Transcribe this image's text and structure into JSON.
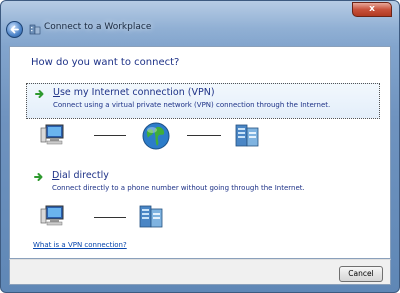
{
  "window": {
    "title": "Connect to a Workplace",
    "close_label": "x"
  },
  "main": {
    "heading": "How do you want to connect?",
    "options": [
      {
        "title_underlined": "U",
        "title_rest": "se my Internet connection (VPN)",
        "description": "Connect using a virtual private network (VPN) connection through the Internet."
      },
      {
        "title_underlined": "D",
        "title_rest": "ial directly",
        "description": "Connect directly to a phone number without going through the Internet."
      }
    ],
    "help_link": "What is a VPN connection?"
  },
  "footer": {
    "cancel_label": "Cancel"
  },
  "colors": {
    "accent_text": "#1e3287",
    "link": "#0645ad",
    "arrow_green": "#2f9a2f"
  },
  "icons": [
    "back-arrow-icon",
    "network-workplace-icon",
    "computer-icon",
    "globe-icon",
    "server-icon",
    "green-arrow-icon"
  ]
}
